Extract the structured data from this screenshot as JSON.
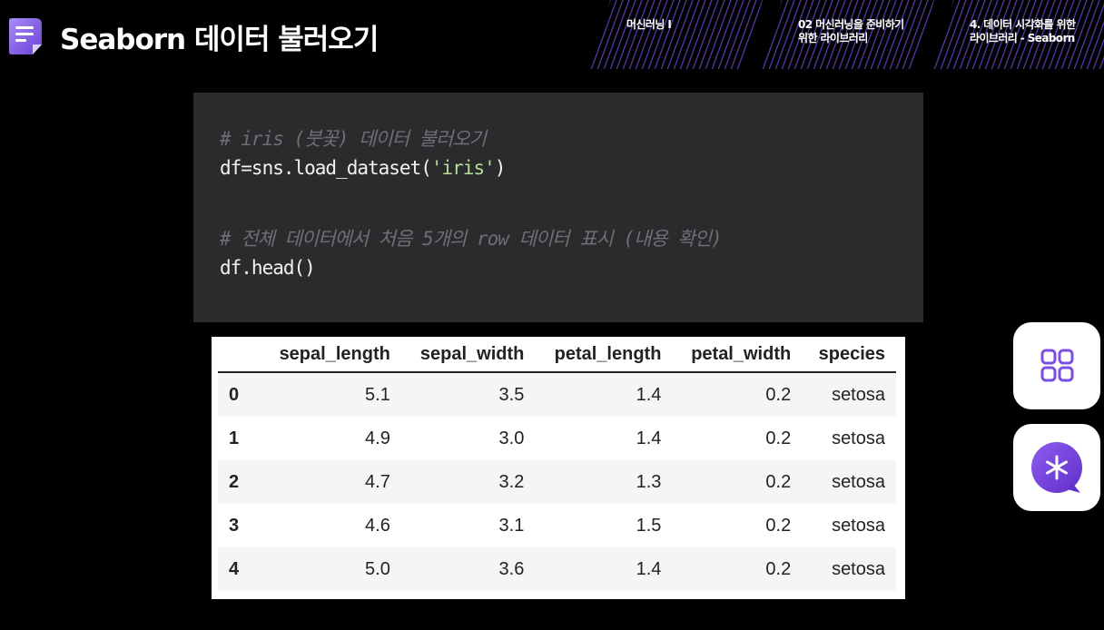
{
  "header": {
    "title": "Seaborn 데이터 불러오기",
    "icon": "document-icon",
    "breadcrumbs": [
      {
        "line1": "머신러닝 I",
        "line2": ""
      },
      {
        "line1": "02 머신러닝을 준비하기",
        "line2": "위한 라이브러리"
      },
      {
        "line1": "4. 데이터 시각화를 위한",
        "line2": "라이브러리 - Seaborn"
      }
    ]
  },
  "code": {
    "line1_comment": "# iris (붓꽃) 데이터 불러오기",
    "line2_prefix": "df=sns.load_dataset(",
    "line2_string": "'iris'",
    "line2_suffix": ")",
    "line3_comment": "# 전체 데이터에서 처음 5개의 row 데이터 표시 (내용 확인)",
    "line4": "df.head()"
  },
  "dataframe": {
    "columns": [
      "",
      "sepal_length",
      "sepal_width",
      "petal_length",
      "petal_width",
      "species"
    ],
    "rows": [
      [
        "0",
        "5.1",
        "3.5",
        "1.4",
        "0.2",
        "setosa"
      ],
      [
        "1",
        "4.9",
        "3.0",
        "1.4",
        "0.2",
        "setosa"
      ],
      [
        "2",
        "4.7",
        "3.2",
        "1.3",
        "0.2",
        "setosa"
      ],
      [
        "3",
        "4.6",
        "3.1",
        "1.5",
        "0.2",
        "setosa"
      ],
      [
        "4",
        "5.0",
        "3.6",
        "1.4",
        "0.2",
        "setosa"
      ]
    ]
  },
  "floating_buttons": [
    {
      "icon": "apps-grid-icon"
    },
    {
      "icon": "ai-chat-icon"
    }
  ],
  "colors": {
    "accent": "#7b4fe0",
    "code_bg": "#2b2b2e",
    "comment": "#6e6e74",
    "string": "#b6dc9a"
  }
}
